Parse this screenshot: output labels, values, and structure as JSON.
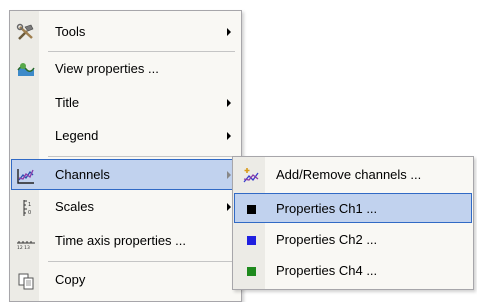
{
  "context_menu": {
    "items": [
      {
        "label": "Tools",
        "icon": "tools-icon",
        "has_submenu": true
      },
      {
        "label": "View properties ...",
        "icon": "view-properties-icon",
        "has_submenu": false
      },
      {
        "label": "Title",
        "icon": "",
        "has_submenu": true
      },
      {
        "label": "Legend",
        "icon": "",
        "has_submenu": true
      },
      {
        "label": "Channels",
        "icon": "channels-icon",
        "has_submenu": true,
        "highlighted": true
      },
      {
        "label": "Scales",
        "icon": "scales-icon",
        "has_submenu": true
      },
      {
        "label": "Time axis properties ...",
        "icon": "time-axis-icon",
        "has_submenu": false
      },
      {
        "label": "Copy",
        "icon": "copy-icon",
        "has_submenu": false
      }
    ]
  },
  "channels_submenu": {
    "items": [
      {
        "label": "Add/Remove channels ...",
        "icon": "add-remove-channels-icon"
      },
      {
        "label": "Properties Ch1 ...",
        "color": "#000000",
        "highlighted": true
      },
      {
        "label": "Properties Ch2 ...",
        "color": "#1f1fe0"
      },
      {
        "label": "Properties Ch4 ...",
        "color": "#1e8a1e"
      }
    ]
  },
  "colors": {
    "highlight_bg": "#c1d2ee",
    "highlight_border": "#316ac5",
    "menu_bg": "#f9f8f4",
    "gutter_bg": "#ecebe6"
  }
}
